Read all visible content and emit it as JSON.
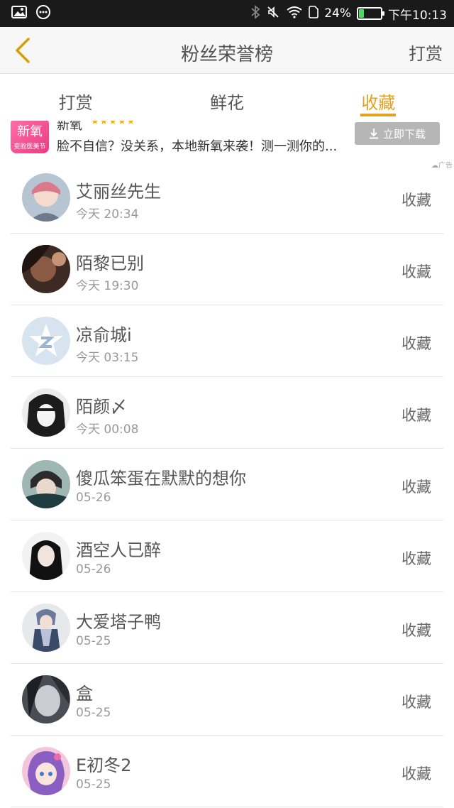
{
  "status_bar": {
    "battery_percent": "24%",
    "battery_level": 0.24,
    "time": "下午10:13",
    "icons": [
      "gallery-icon",
      "message-icon",
      "bluetooth-icon",
      "mute-icon",
      "wifi-icon",
      "sim-icon",
      "battery-icon"
    ]
  },
  "header": {
    "title": "粉丝荣誉榜",
    "right_action": "打赏",
    "back_icon": "chevron-left-icon"
  },
  "tabs": [
    {
      "label": "打赏",
      "active": false
    },
    {
      "label": "鲜花",
      "active": false
    },
    {
      "label": "收藏",
      "active": true
    }
  ],
  "ad": {
    "logo_text": "新氧",
    "logo_subtext": "变脸医美节",
    "name": "新氧",
    "stars": "★★★★★",
    "description": "脸不自信？没关系，本地新氧来袭！测一测你的...",
    "button": "立即下载",
    "label": "广告"
  },
  "fans": [
    {
      "name": "艾丽丝先生",
      "time": "今天 20:34",
      "action": "收藏"
    },
    {
      "name": "陌黎已别",
      "time": "今天 19:30",
      "action": "收藏"
    },
    {
      "name": "凉俞城i",
      "time": "今天 03:15",
      "action": "收藏"
    },
    {
      "name": "陌颜〆",
      "time": "今天 00:08",
      "action": "收藏"
    },
    {
      "name": "傻瓜笨蛋在默默的想你",
      "time": "05-26",
      "action": "收藏"
    },
    {
      "name": "酒空人已醉",
      "time": "05-26",
      "action": "收藏"
    },
    {
      "name": "大爱塔子鸭",
      "time": "05-25",
      "action": "收藏"
    },
    {
      "name": "盒",
      "time": "05-25",
      "action": "收藏"
    },
    {
      "name": "E初冬2",
      "time": "05-25",
      "action": "收藏"
    }
  ],
  "colors": {
    "accent": "#e5a124",
    "status_bar": "#1a1a1a",
    "header_bg": "#f7f7f7"
  }
}
